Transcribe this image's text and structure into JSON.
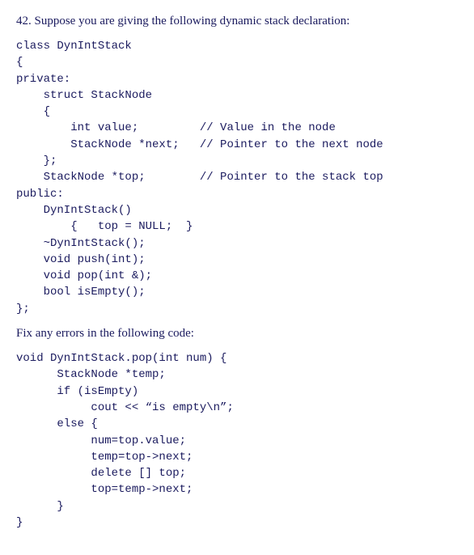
{
  "question": {
    "number": "42.",
    "prompt": "Suppose you are giving the following dynamic stack declaration:"
  },
  "code1": "class DynIntStack\n{\nprivate:\n    struct StackNode\n    {\n        int value;         // Value in the node\n        StackNode *next;   // Pointer to the next node\n    };\n    StackNode *top;        // Pointer to the stack top\npublic:\n    DynIntStack()\n        {   top = NULL;  }\n    ~DynIntStack();\n    void push(int);\n    void pop(int &);\n    bool isEmpty();\n};",
  "instruction": "Fix any errors in the following code:",
  "code2": "void DynIntStack.pop(int num) {\n      StackNode *temp;\n      if (isEmpty)\n           cout << “is empty\\n”;\n      else {\n           num=top.value;\n           temp=top->next;\n           delete [] top;\n           top=temp->next;\n      }\n}"
}
